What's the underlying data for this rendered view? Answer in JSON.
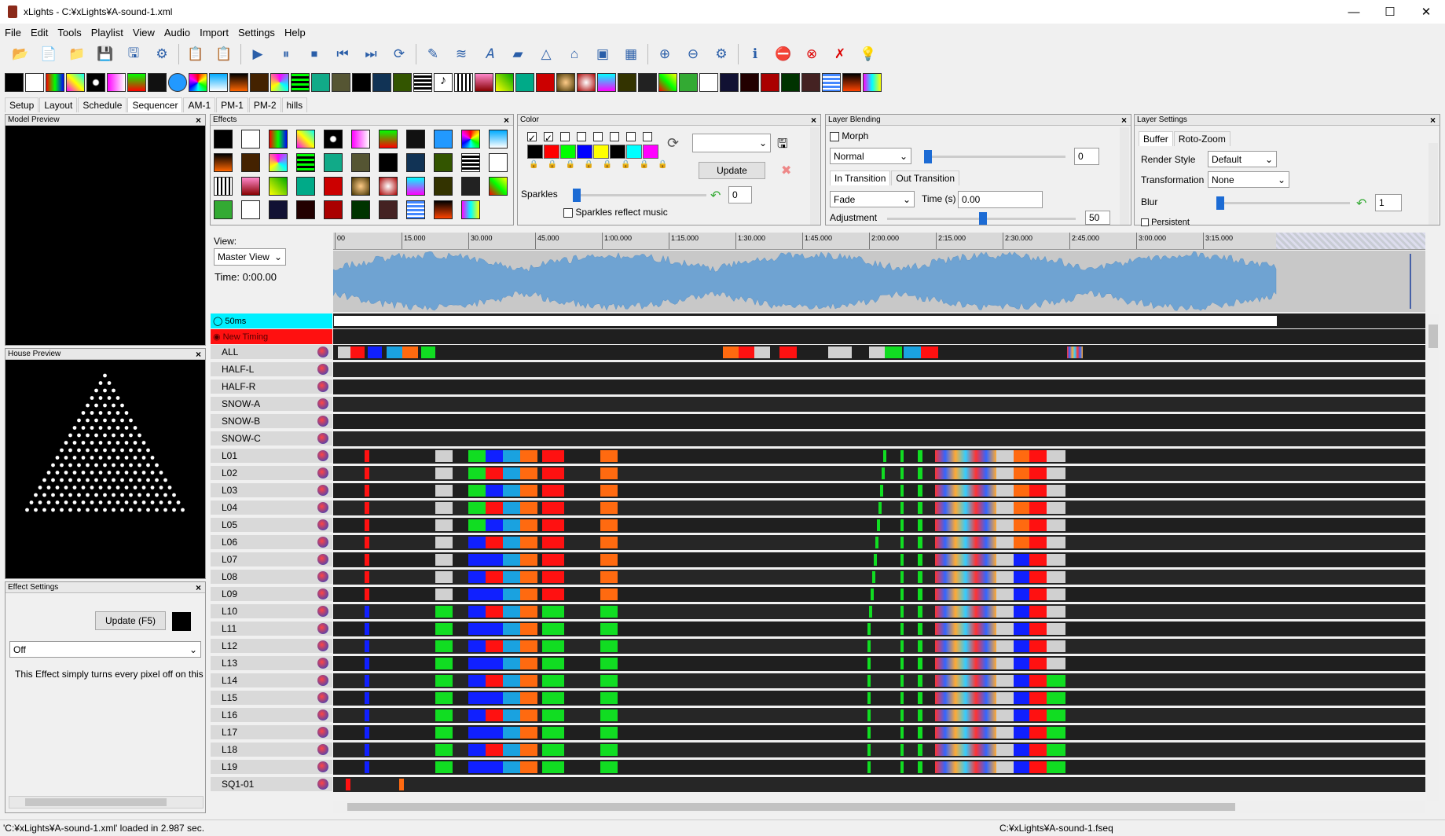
{
  "window": {
    "title": "xLights - C:¥xLights¥A-sound-1.xml",
    "min": "—",
    "max": "☐",
    "close": "✕"
  },
  "menu": [
    "File",
    "Edit",
    "Tools",
    "Playlist",
    "View",
    "Audio",
    "Import",
    "Settings",
    "Help"
  ],
  "tabs": [
    "Setup",
    "Layout",
    "Schedule",
    "Sequencer",
    "AM-1",
    "PM-1",
    "PM-2",
    "hills"
  ],
  "active_tab": "Sequencer",
  "panels": {
    "model_preview": "Model Preview",
    "house_preview": "House Preview",
    "effect_settings": "Effect Settings",
    "effects": "Effects",
    "color": "Color",
    "layer_blending": "Layer Blending",
    "layer_settings": "Layer Settings"
  },
  "effect_settings": {
    "update": "Update (F5)",
    "effect": "Off",
    "description": "This Effect simply turns every pixel off on this"
  },
  "color_panel": {
    "update": "Update",
    "sparkles_label": "Sparkles",
    "sparkles_value": "0",
    "sparkles_reflect": "Sparkles reflect music",
    "palette": [
      "#000000",
      "#ff0000",
      "#00ff00",
      "#0000ff",
      "#ffff00",
      "#000000",
      "#00ffff",
      "#ff00ff"
    ]
  },
  "layer_blending": {
    "morph": "Morph",
    "mode": "Normal",
    "mode_value": "0",
    "in_tab": "In Transition",
    "out_tab": "Out Transition",
    "transition": "Fade",
    "time_label": "Time (s)",
    "time_value": "0.00",
    "adjustment_label": "Adjustment",
    "adjustment_value": "50"
  },
  "layer_settings": {
    "buffer_tab": "Buffer",
    "roto_tab": "Roto-Zoom",
    "render_style_label": "Render Style",
    "render_style": "Default",
    "transformation_label": "Transformation",
    "transformation": "None",
    "blur_label": "Blur",
    "blur_value": "1",
    "persistent": "Persistent"
  },
  "view": {
    "label": "View:",
    "selected": "Master View",
    "time": "Time: 0:00.00"
  },
  "timeline_ticks": [
    "00",
    "15.000",
    "30.000",
    "45.000",
    "1:00.000",
    "1:15.000",
    "1:30.000",
    "1:45.000",
    "2:00.000",
    "2:15.000",
    "2:30.000",
    "2:45.000",
    "3:00.000",
    "3:15.000"
  ],
  "timing_tracks": [
    "50ms",
    "New Timing"
  ],
  "rows": [
    "ALL",
    "HALF-L",
    "HALF-R",
    "SNOW-A",
    "SNOW-B",
    "SNOW-C",
    "L01",
    "L02",
    "L03",
    "L04",
    "L05",
    "L06",
    "L07",
    "L08",
    "L09",
    "L10",
    "L11",
    "L12",
    "L13",
    "L14",
    "L15",
    "L16",
    "L17",
    "L18",
    "L19",
    "SQ1-01"
  ],
  "status": {
    "left": "'C:¥xLights¥A-sound-1.xml' loaded in 2.987 sec.",
    "right": "C:¥xLights¥A-sound-1.fseq"
  }
}
